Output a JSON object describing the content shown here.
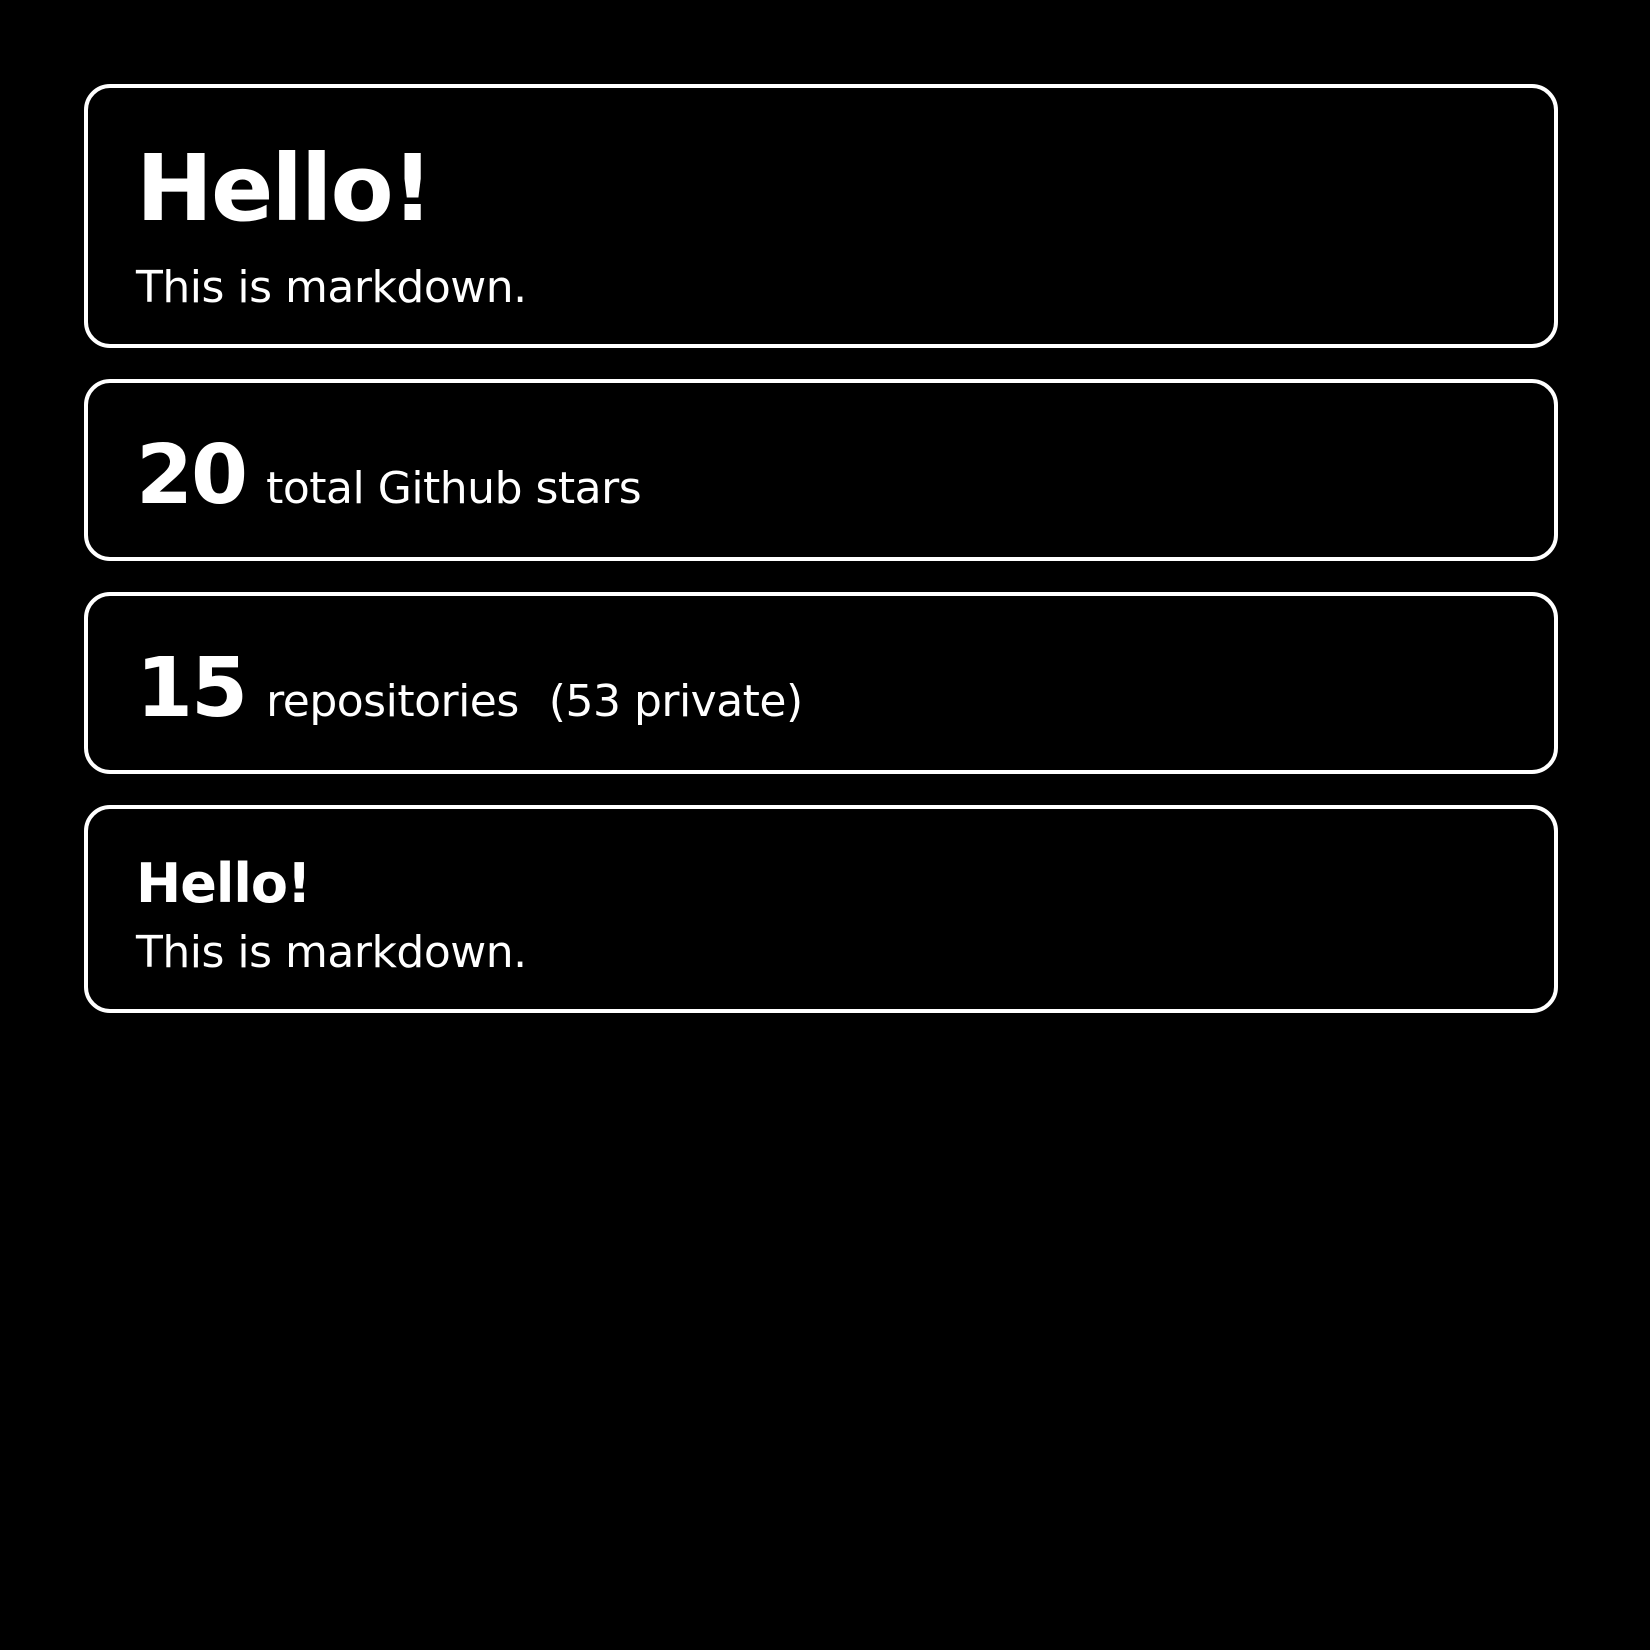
{
  "cards": [
    {
      "heading": "Hello!",
      "text": "This is markdown."
    },
    {
      "count": "20",
      "label": "total Github stars"
    },
    {
      "count": "15",
      "label": "repositories",
      "extra": "(53 private)"
    },
    {
      "heading": "Hello!",
      "text": "This is markdown."
    }
  ],
  "colors": {
    "background": "#000000",
    "foreground": "#ffffff"
  }
}
